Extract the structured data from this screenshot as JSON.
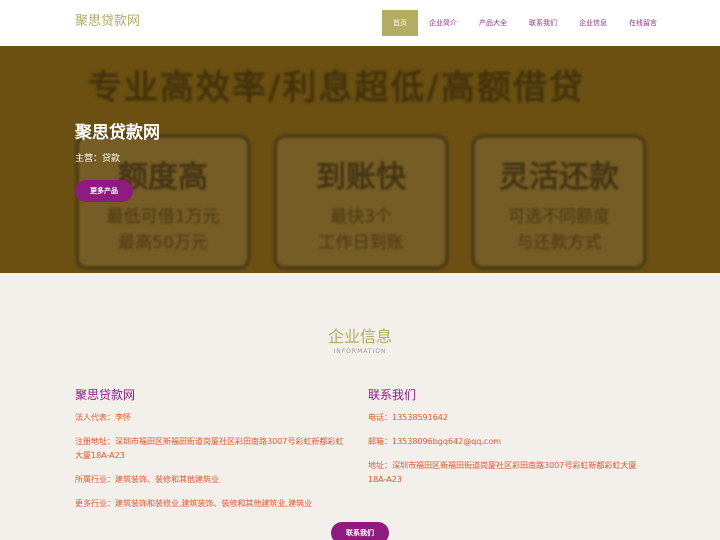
{
  "header": {
    "brand": "聚思贷款网",
    "nav": [
      "首页",
      "企业简介",
      "产品大全",
      "联系我们",
      "企业信息",
      "在线留言"
    ]
  },
  "hero": {
    "bg_headline": "专业高效率/利息超低/高额借贷",
    "cards": [
      {
        "big": "额度高",
        "line1": "最低可借1万元",
        "line2": "最高50万元"
      },
      {
        "big": "到账快",
        "line1": "最快3个",
        "line2": "工作日到账"
      },
      {
        "big": "灵活还款",
        "line1": "可选不同额度",
        "line2": "与还款方式"
      }
    ],
    "title": "聚思贷款网",
    "subtitle": "主营：贷款",
    "button": "更多产品"
  },
  "info": {
    "title": "企业信息",
    "subtitle": "INFORMATION",
    "left": {
      "heading": "聚思贷款网",
      "rows": [
        "法人代表：李怀",
        "注册地址：深圳市福田区新福田街道岗厦社区彩田南路3007号彩虹新都彩虹大厦18A-A23",
        "所属行业：建筑装饰、装修和其他建筑业",
        "更多行业：建筑装饰和装修业,建筑装饰、装修和其他建筑业,建筑业"
      ]
    },
    "right": {
      "heading": "联系我们",
      "rows": [
        "电话：13538591642",
        "邮箱：13538096bgq642@qq.com",
        "地址：深圳市福田区新福田街道岗厦社区彩田南路3007号彩虹新都彩虹大厦18A-A23"
      ]
    },
    "button": "联系我们"
  }
}
